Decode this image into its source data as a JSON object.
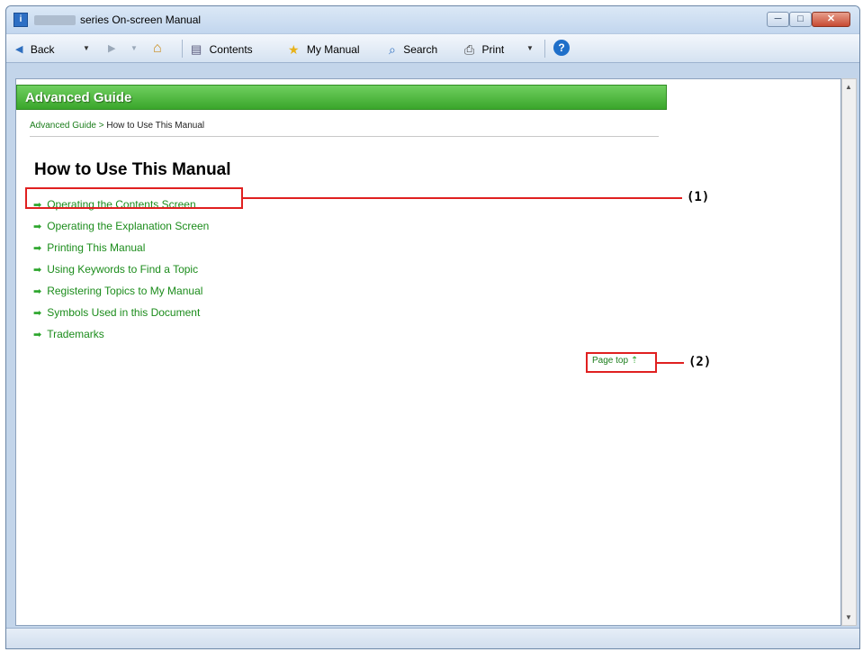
{
  "window": {
    "title": "series On-screen Manual",
    "app_icon": "manual-app-icon",
    "caption_buttons": {
      "minimize": "─",
      "maximize": "□",
      "close": "✕"
    }
  },
  "toolbar": {
    "back_label": "Back",
    "contents_label": "Contents",
    "my_manual_label": "My Manual",
    "search_label": "Search",
    "print_label": "Print",
    "icons": {
      "back": "◀",
      "forward": "▶",
      "dropdown": "▼",
      "home": "⌂",
      "contents": "▤",
      "star": "★",
      "search": "⌕",
      "print": "⎙",
      "help": "?"
    }
  },
  "content": {
    "header_title": "Advanced Guide",
    "breadcrumb": {
      "parent": "Advanced Guide",
      "separator": " > ",
      "current": "How to Use This Manual"
    },
    "page_title": "How to Use This Manual",
    "links": [
      "Operating the Contents Screen",
      "Operating the Explanation Screen",
      "Printing This Manual",
      "Using Keywords to Find a Topic",
      "Registering Topics to My Manual",
      "Symbols Used in this Document",
      "Trademarks"
    ],
    "link_arrow": "➡",
    "page_top_label": "Page top",
    "page_top_arrow": "⇡"
  },
  "callouts": {
    "label_1": "(1)",
    "label_2": "(2)"
  },
  "colors": {
    "accent_green": "#3aa62b",
    "link_green": "#1b8c1b",
    "callout_red": "#e02020"
  }
}
